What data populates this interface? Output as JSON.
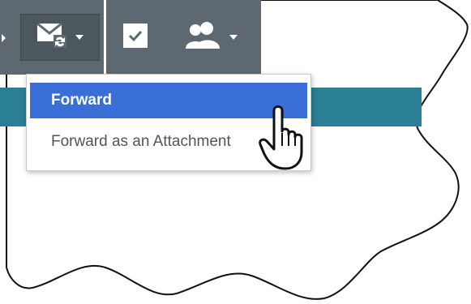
{
  "toolbar": {
    "buttons": [
      {
        "name": "forward-options",
        "icon": "envelope-forward-icon",
        "has_dropdown": true,
        "active": true
      },
      {
        "name": "mark-complete",
        "icon": "checkbox-checked-icon",
        "has_dropdown": false
      },
      {
        "name": "assign-contact",
        "icon": "person-icon",
        "has_dropdown": true
      }
    ]
  },
  "menu": {
    "items": [
      {
        "label": "Forward",
        "selected": true
      },
      {
        "label": "Forward as an Attachment",
        "selected": false
      }
    ]
  },
  "colors": {
    "toolbar_bg": "#5d6870",
    "band": "#2b7f95",
    "selected_item": "#3a6fd8",
    "menu_text": "#555555"
  },
  "pointer": {
    "icon": "hand-pointer-icon"
  }
}
